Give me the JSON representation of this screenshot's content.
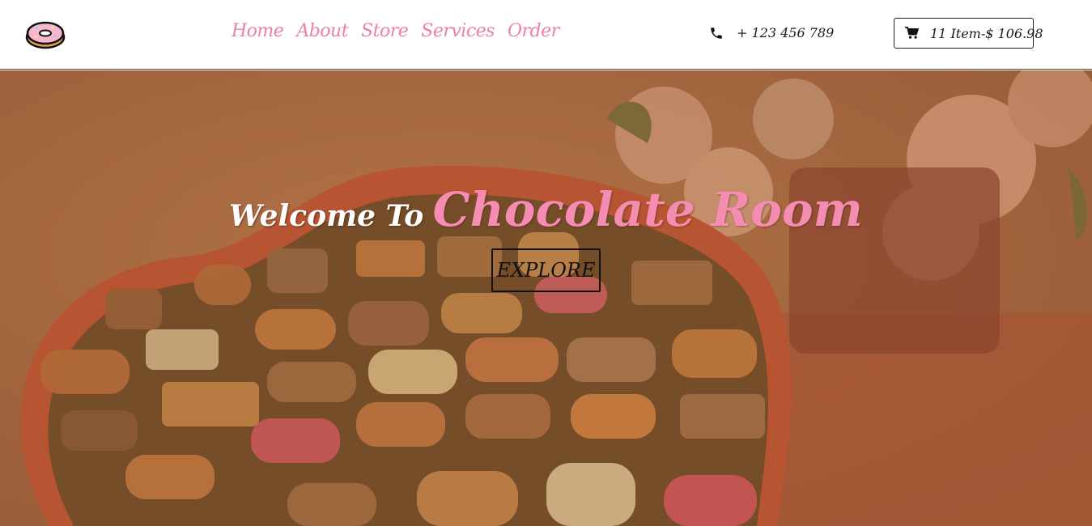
{
  "header": {
    "logo_icon": "donut-icon",
    "nav": [
      {
        "label": "Home"
      },
      {
        "label": "About"
      },
      {
        "label": "Store"
      },
      {
        "label": "Services"
      },
      {
        "label": "Order"
      }
    ],
    "phone": {
      "icon": "phone-icon",
      "text": "+ 123 456 789"
    },
    "cart": {
      "icon": "cart-icon",
      "text": "11 Item-$ 106.98"
    }
  },
  "hero": {
    "title_lead": "Welcome To",
    "title_brand": "Chocolate Room",
    "button_label": "EXPLORE",
    "background_image": "heart-shaped-chocolate-box-photo"
  },
  "colors": {
    "accent_pink": "#ee7fa6",
    "hero_overlay": "#a7683f",
    "brand_pink": "#f58cb2"
  }
}
